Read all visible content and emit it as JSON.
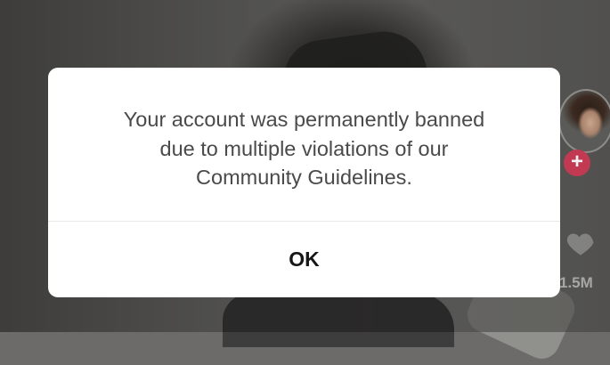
{
  "dialog": {
    "message": "Your account was permanently banned\ndue to multiple violations of our\nCommunity Guidelines.",
    "ok_label": "OK"
  },
  "right_rail": {
    "follow_icon": "plus-icon",
    "follow_glyph": "+",
    "like_icon": "heart-icon",
    "like_count": "1.5M"
  },
  "colors": {
    "dialog_background": "#ffffff",
    "message_text": "#4a4a4a",
    "ok_text": "#161616",
    "follow_badge": "#c23a52"
  }
}
